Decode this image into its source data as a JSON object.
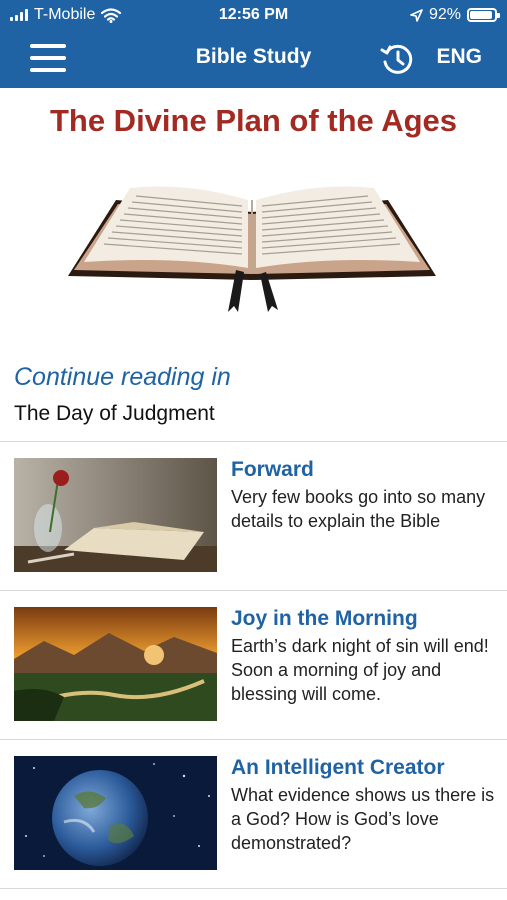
{
  "status_bar": {
    "carrier": "T-Mobile",
    "time": "12:56 PM",
    "battery": "92%",
    "battery_level": 0.92
  },
  "header": {
    "title": "Bible Study",
    "language": "ENG",
    "menu_icon": "hamburger-menu-icon",
    "history_icon": "history-clock-icon",
    "color": "#1f63a5"
  },
  "book": {
    "title": "The Divine Plan of the Ages",
    "title_color": "#a32a22"
  },
  "continue_reading": {
    "label": "Continue reading in",
    "chapter": "The Day of Judgment"
  },
  "chapters": [
    {
      "title": "Forward",
      "description": "Very few books go into so many details to explain the Bible"
    },
    {
      "title": "Joy in the Morning",
      "description": "Earth’s dark night of sin will end! Soon a morning of joy and blessing will come."
    },
    {
      "title": "An Intelligent Creator",
      "description": "What evidence shows us there is a God? How is God’s love demonstrated?"
    }
  ]
}
